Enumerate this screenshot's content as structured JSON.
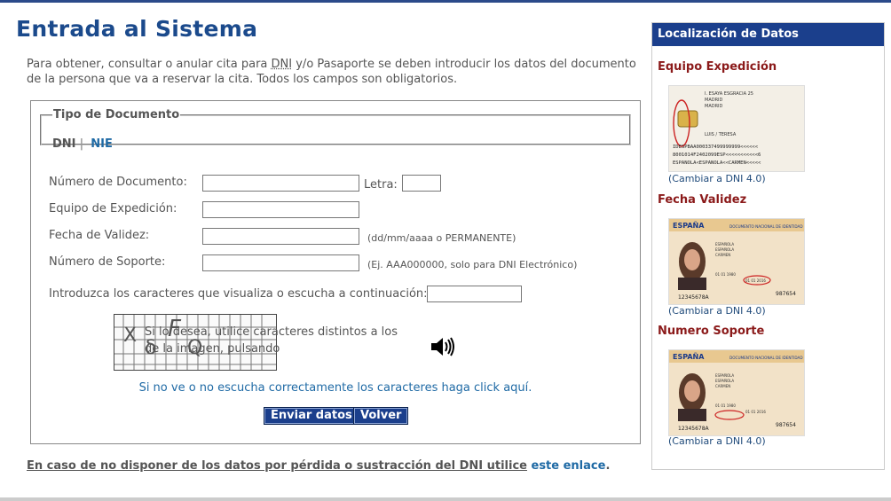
{
  "page": {
    "title": "Entrada al Sistema",
    "intro_pre": "Para obtener, consultar o anular cita para ",
    "intro_abbr": "DNI",
    "intro_post": " y/o Pasaporte se deben introducir los datos del documento de la persona que va a reservar la cita. Todos los campos son obligatorios."
  },
  "tipo_documento": {
    "legend": "Tipo de Documento",
    "dni": "DNI",
    "separator": "|",
    "nie": "NIE"
  },
  "form": {
    "numero_label": "Número de Documento:",
    "letra_label": "Letra:",
    "equipo_label": "Equipo de Expedición:",
    "fecha_label": "Fecha de Validez:",
    "fecha_hint": "(dd/mm/aaaa o PERMANENTE)",
    "soporte_label": "Número de Soporte:",
    "soporte_hint": "(Ej. AAA000000, solo para DNI Electrónico)",
    "captcha_label": "Introduzca los caracteres que visualiza o escucha a continuación:",
    "captcha_text": "Si lo desea, utilice caracteres distintos a los de la imagen, pulsando",
    "captcha_chars": [
      "X",
      "δ",
      "F",
      "Q"
    ],
    "captcha_help_link": "Si no ve o no escucha correctamente los caracteres haga click aquí.",
    "submit": "Enviar datos",
    "back": "Volver"
  },
  "footer_note": {
    "text": "En caso de no disponer de los datos por pérdida o sustracción del DNI utilice",
    "link": "este enlace",
    "period": "."
  },
  "sidebar": {
    "title": "Localización de Datos",
    "sections": [
      {
        "heading": "Equipo Expedición",
        "link": "(Cambiar a DNI 4.0)",
        "card": {
          "l1": "I. ESAYA ESGRACIA 25",
          "l2": "MADRID",
          "l3": "MADRID",
          "l4": "LUIS / TERESA",
          "mrz1": "IDESPBAA000337499999999<<<<<<",
          "mrz2": "8001014F2402099ESP<<<<<<<<<<<6",
          "mrz3": "ESPANOLA<ESPANOLA<<CARMEN<<<<<"
        }
      },
      {
        "heading": "Fecha Validez",
        "link": "(Cambiar a DNI 4.0)",
        "card": {
          "country": "ESPAÑA",
          "doc": "DOCUMENTO NACIONAL DE IDENTIDAD",
          "n1": "ESPAÑOLA",
          "n2": "ESPAÑOLA",
          "n3": "CARMEN",
          "date1": "01 01 1980",
          "date2": "01 01 2016",
          "num": "12345678A",
          "code": "987654"
        }
      },
      {
        "heading": "Numero Soporte",
        "link": "(Cambiar a DNI 4.0)",
        "card": {
          "country": "ESPAÑA",
          "doc": "DOCUMENTO NACIONAL DE IDENTIDAD",
          "n1": "ESPAÑOLA",
          "n2": "ESPAÑOLA",
          "n3": "CARMEN",
          "date1": "01 01 1980",
          "date2": "01 01 2016",
          "num": "12345678A",
          "code": "987654"
        }
      }
    ]
  }
}
